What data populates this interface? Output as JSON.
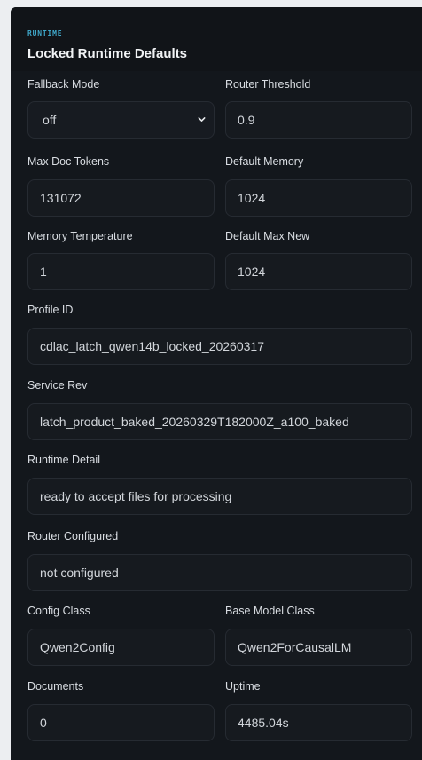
{
  "header": {
    "eyebrow": "RUNTIME",
    "title": "Locked Runtime Defaults"
  },
  "fields": {
    "fallback_mode": {
      "label": "Fallback Mode",
      "value": "off"
    },
    "router_threshold": {
      "label": "Router Threshold",
      "value": "0.9"
    },
    "max_doc_tokens": {
      "label": "Max Doc Tokens",
      "value": "131072"
    },
    "default_memory": {
      "label": "Default Memory",
      "value": "1024"
    },
    "memory_temperature": {
      "label": "Memory Temperature",
      "value": "1"
    },
    "default_max_new": {
      "label": "Default Max New",
      "value": "1024"
    },
    "profile_id": {
      "label": "Profile ID",
      "value": "cdlac_latch_qwen14b_locked_20260317"
    },
    "service_rev": {
      "label": "Service Rev",
      "value": "latch_product_baked_20260329T182000Z_a100_baked"
    },
    "runtime_detail": {
      "label": "Runtime Detail",
      "value": "ready to accept files for processing"
    },
    "router_configured": {
      "label": "Router Configured",
      "value": "not configured"
    },
    "config_class": {
      "label": "Config Class",
      "value": "Qwen2Config"
    },
    "base_model_class": {
      "label": "Base Model Class",
      "value": "Qwen2ForCausalLM"
    },
    "documents": {
      "label": "Documents",
      "value": "0"
    },
    "uptime": {
      "label": "Uptime",
      "value": "4485.04s"
    }
  },
  "icons": {
    "select_chevron": "chevron-down-icon"
  },
  "colors": {
    "panel_bg": "#13171c",
    "field_bg": "#161a1f",
    "accent": "#3fa7c9",
    "text": "#d9dde2"
  }
}
